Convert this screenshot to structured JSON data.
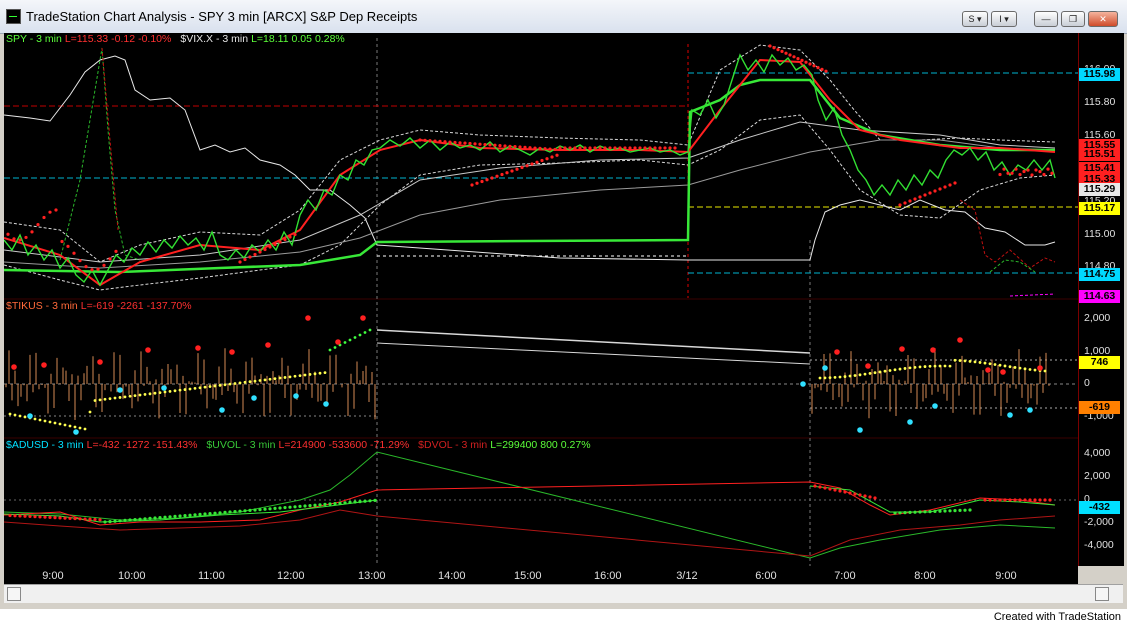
{
  "window": {
    "title": "TradeStation Chart Analysis - SPY 3 min [ARCX] S&P Dep Receipts",
    "controls": {
      "s_button": "S",
      "i_button": "I",
      "minimize": "—",
      "restore": "❐",
      "close": "✕"
    }
  },
  "panes": {
    "price": {
      "legend": [
        {
          "text": "SPY - 3 min",
          "color": "#5cff3a"
        },
        {
          "text": "L=115.33",
          "color": "#ff3030"
        },
        {
          "text": "-0.12",
          "color": "#ff3030"
        },
        {
          "text": "-0.10%",
          "color": "#ff3030"
        },
        {
          "text": "$VIX.X - 3 min",
          "color": "#e6e6e6"
        },
        {
          "text": "L=18.11",
          "color": "#5cff3a"
        },
        {
          "text": "0.05",
          "color": "#5cff3a"
        },
        {
          "text": "0.28%",
          "color": "#5cff3a"
        }
      ],
      "ticks": [
        "116.00",
        "115.80",
        "115.60",
        "115.40",
        "115.20",
        "115.00",
        "114.80"
      ],
      "tags": [
        {
          "text": "115.98",
          "bg": "#00d8ff",
          "fg": "#000000"
        },
        {
          "text": "115.55",
          "bg": "#ff2020",
          "fg": "#000000"
        },
        {
          "text": "115.51",
          "bg": "#ff2020",
          "fg": "#000000"
        },
        {
          "text": "115.41",
          "bg": "#ff2020",
          "fg": "#000000"
        },
        {
          "text": "115.33",
          "bg": "#ff2020",
          "fg": "#000000"
        },
        {
          "text": "115.29",
          "bg": "#e8e8e8",
          "fg": "#000000"
        },
        {
          "text": "115.17",
          "bg": "#ffff00",
          "fg": "#000000"
        },
        {
          "text": "114.75",
          "bg": "#00d8ff",
          "fg": "#000000"
        },
        {
          "text": "114.63",
          "bg": "#ff00ff",
          "fg": "#000000"
        }
      ]
    },
    "tikus": {
      "legend": [
        {
          "text": "$TIKUS - 3 min",
          "color": "#ff6a3a"
        },
        {
          "text": "L=-619",
          "color": "#ff3030"
        },
        {
          "text": "-2261",
          "color": "#ff3030"
        },
        {
          "text": "-137.70%",
          "color": "#ff3030"
        }
      ],
      "ticks": [
        "2,000",
        "1,000",
        "0",
        "-1,000"
      ],
      "tags": [
        {
          "text": "746",
          "bg": "#ffff00",
          "fg": "#000000"
        },
        {
          "text": "-619",
          "bg": "#ff8000",
          "fg": "#000000"
        }
      ]
    },
    "adusd": {
      "legend": [
        {
          "text": "$ADUSD - 3 min",
          "color": "#00e0ff"
        },
        {
          "text": "L=-432",
          "color": "#ff3030"
        },
        {
          "text": "-1272",
          "color": "#ff3030"
        },
        {
          "text": "-151.43%",
          "color": "#ff3030"
        },
        {
          "text": "$UVOL - 3 min",
          "color": "#38c838"
        },
        {
          "text": "L=214900",
          "color": "#ff3030"
        },
        {
          "text": "-533600",
          "color": "#ff3030"
        },
        {
          "text": "-71.29%",
          "color": "#ff3030"
        },
        {
          "text": "$DVOL - 3 min",
          "color": "#d02020"
        },
        {
          "text": "L=299400",
          "color": "#5cff3a"
        },
        {
          "text": "800",
          "color": "#5cff3a"
        },
        {
          "text": "0.27%",
          "color": "#5cff3a"
        }
      ],
      "ticks": [
        "4,000",
        "2,000",
        "0",
        "-2,000",
        "-4,000"
      ],
      "tags": [
        {
          "text": "-432",
          "bg": "#00e0ff",
          "fg": "#000000"
        }
      ]
    }
  },
  "time_axis": [
    "9:00",
    "10:00",
    "11:00",
    "12:00",
    "13:00",
    "14:00",
    "15:00",
    "16:00",
    "3/12",
    "6:00",
    "7:00",
    "8:00",
    "9:00"
  ],
  "footer": {
    "credit": "Created with TradeStation"
  }
}
